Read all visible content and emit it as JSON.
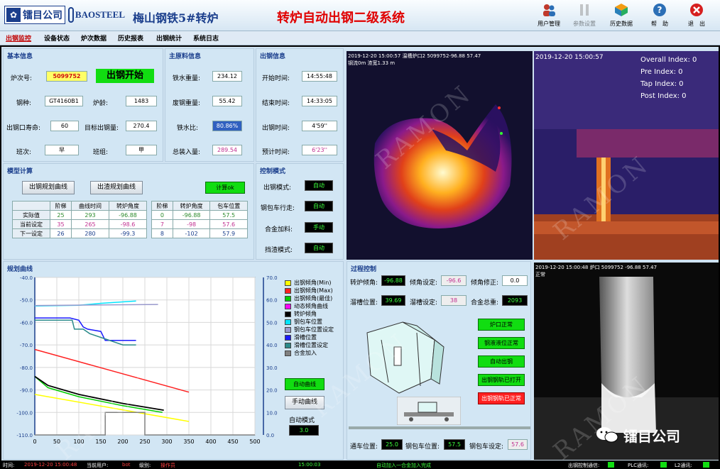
{
  "header": {
    "company_logo_text": "镭目公司",
    "baosteel_logo_text": "BAOSTEEL",
    "plant_title": "梅山钢铁5#转炉",
    "system_title": "转炉自动出钢二级系统",
    "toolbar": [
      {
        "label": "用户管理",
        "icon": "users-icon"
      },
      {
        "label": "参数设置",
        "icon": "settings-icon"
      },
      {
        "label": "历史数据",
        "icon": "history-icon"
      },
      {
        "label": "帮　助",
        "icon": "help-icon"
      },
      {
        "label": "退　出",
        "icon": "exit-icon"
      }
    ]
  },
  "menu": [
    "出钢监控",
    "设备状态",
    "炉次数据",
    "历史报表",
    "出钢统计",
    "系统日志"
  ],
  "basic_info": {
    "title": "基本信息",
    "heat_no_label": "炉次号:",
    "heat_no": "5099752",
    "tap_status": "出钢开始",
    "grade_label": "钢种:",
    "grade": "GT4160B1",
    "furnace_age_label": "炉龄:",
    "furnace_age": "1483",
    "tap_hole_life_label": "出钢口寿命:",
    "tap_hole_life": "60",
    "target_weight_label": "目标出钢量:",
    "target_weight": "270.4",
    "shift_label": "班次:",
    "shift": "早",
    "team_label": "班组:",
    "team": "甲"
  },
  "material_info": {
    "title": "主原料信息",
    "iron_weight_label": "铁水重量:",
    "iron_weight": "234.12",
    "scrap_weight_label": "废钢重量:",
    "scrap_weight": "55.42",
    "iron_ratio_label": "铁水比:",
    "iron_ratio": "80.86%",
    "total_charge_label": "总装入量:",
    "total_charge": "289.54"
  },
  "tap_info": {
    "title": "出钢信息",
    "start_label": "开始时间:",
    "start": "14:55:48",
    "end_label": "结束时间:",
    "end": "14:33:05",
    "duration_label": "出钢时间:",
    "duration": "4'59''",
    "predicted_label": "预计时间:",
    "predicted": "6'23''"
  },
  "model_calc": {
    "title": "模型计算",
    "btn_tap_curve": "出钢规划曲线",
    "btn_slag_curve": "出渣规划曲线",
    "btn_calc": "计算ok",
    "table_left": {
      "headers": [
        "",
        "阶梯",
        "曲线时间",
        "转炉角度"
      ],
      "rows": [
        [
          "实际值",
          "25",
          "293",
          "-96.88"
        ],
        [
          "当前设定",
          "35",
          "265",
          "-98.6"
        ],
        [
          "下一设定",
          "26",
          "280",
          "-99.3"
        ]
      ]
    },
    "table_right": {
      "headers": [
        "阶梯",
        "转炉角度",
        "包车位置"
      ],
      "rows": [
        [
          "0",
          "-96.88",
          "57.5"
        ],
        [
          "7",
          "-98",
          "57.6"
        ],
        [
          "8",
          "-102",
          "57.9"
        ]
      ]
    }
  },
  "control_mode": {
    "title": "控制模式",
    "items": [
      {
        "label": "出钢模式:",
        "value": "自动"
      },
      {
        "label": "钢包车行走:",
        "value": "自动"
      },
      {
        "label": "合金加料:",
        "value": "手动"
      },
      {
        "label": "挡渣模式:",
        "value": "自动"
      }
    ]
  },
  "planning_curve": {
    "title": "规划曲线",
    "legend": [
      {
        "label": "出钢倾角(Min)",
        "color": "#ffff00"
      },
      {
        "label": "出钢倾角(Max)",
        "color": "#ff2020"
      },
      {
        "label": "出钢倾角(最佳)",
        "color": "#00cc00"
      },
      {
        "label": "动态倾角曲线",
        "color": "#ff00ff"
      },
      {
        "label": "转炉倾角",
        "color": "#000000"
      },
      {
        "label": "钢包车位置",
        "color": "#00e5ff"
      },
      {
        "label": "钢包车位置设定",
        "color": "#9999cc"
      },
      {
        "label": "滑槽位置",
        "color": "#1a1aff"
      },
      {
        "label": "滑槽位置设定",
        "color": "#2a8a8a"
      },
      {
        "label": "合金加入",
        "color": "#808080"
      }
    ],
    "btn_auto_curve": "自动曲线",
    "btn_manual_curve": "手动曲线",
    "auto_mode_label": "自动模式",
    "auto_mode_value": "3.0"
  },
  "chart_data": {
    "type": "line",
    "x_ticks": [
      "0",
      "50",
      "100",
      "150",
      "200",
      "250",
      "300",
      "350",
      "400",
      "450",
      "500"
    ],
    "y_left_ticks": [
      "-40.0",
      "-50.0",
      "-60.0",
      "-70.0",
      "-80.0",
      "-90.0",
      "-100.0",
      "-110.0"
    ],
    "y_right_ticks": [
      "70.0",
      "60.0",
      "50.0",
      "40.0",
      "30.0",
      "20.0",
      "10.0",
      "0.0"
    ],
    "xlim": [
      0,
      500
    ],
    "ylim_left": [
      -110,
      -40
    ],
    "ylim_right": [
      0,
      70
    ],
    "series": [
      {
        "name": "出钢倾角(Min)",
        "axis": "left",
        "color": "#ffff00",
        "x": [
          0,
          350
        ],
        "y": [
          -92,
          -104
        ]
      },
      {
        "name": "出钢倾角(Max)",
        "axis": "left",
        "color": "#ff2020",
        "x": [
          0,
          350
        ],
        "y": [
          -72,
          -91
        ]
      },
      {
        "name": "出钢倾角(最佳)",
        "axis": "left",
        "color": "#00cc00",
        "x": [
          0,
          30,
          100,
          200,
          290
        ],
        "y": [
          -84,
          -89,
          -93,
          -97,
          -100
        ]
      },
      {
        "name": "转炉倾角",
        "axis": "left",
        "color": "#000000",
        "x": [
          0,
          30,
          100,
          200,
          293
        ],
        "y": [
          -84,
          -88,
          -92,
          -96,
          -99
        ]
      },
      {
        "name": "钢包车位置",
        "axis": "right",
        "color": "#00e5ff",
        "x": [
          0,
          100,
          150,
          230
        ],
        "y": [
          57.3,
          57.6,
          58.5,
          59.5
        ]
      },
      {
        "name": "钢包车位置设定",
        "axis": "right",
        "color": "#9999cc",
        "x": [
          0,
          280
        ],
        "y": [
          57.5,
          58
        ]
      },
      {
        "name": "滑槽位置",
        "axis": "right",
        "color": "#1a1aff",
        "x": [
          0,
          80,
          100,
          110,
          120,
          150,
          160,
          230
        ],
        "y": [
          52,
          52,
          51,
          48,
          47,
          46,
          42,
          42
        ]
      },
      {
        "name": "滑槽位置设定",
        "axis": "right",
        "color": "#2a8a8a",
        "x": [
          0,
          85,
          90,
          110,
          125,
          200,
          230
        ],
        "y": [
          51,
          51,
          47,
          47,
          45,
          40,
          40
        ]
      },
      {
        "name": "合金加入",
        "axis": "right",
        "color": "#808080",
        "x": [
          0,
          160,
          160,
          250,
          250,
          500
        ],
        "y": [
          0,
          0,
          10,
          10,
          0,
          0
        ]
      }
    ]
  },
  "process_control": {
    "title": "过程控制",
    "tilt_label": "转炉倾角:",
    "tilt": "-96.88",
    "tilt_set_label": "倾角设定:",
    "tilt_set": "-96.6",
    "tilt_correction_label": "倾角修正:",
    "tilt_correction": "0.0",
    "chute_pos_label": "溜槽位置:",
    "chute_pos": "39.69",
    "chute_set_label": "溜槽设定:",
    "chute_set": "38",
    "alloy_weight_label": "合金总重:",
    "alloy_weight": "2093",
    "buttons": [
      {
        "label": "炉口正常",
        "color": "#11dd11"
      },
      {
        "label": "钢液液位正常",
        "color": "#11dd11"
      },
      {
        "label": "自动出钢",
        "color": "#11dd11"
      },
      {
        "label": "出钢钢轨已打开",
        "color": "#11dd11"
      },
      {
        "label": "出钢钢轨已正常",
        "color": "#ff2020"
      }
    ],
    "car_pos_label": "通车位置:",
    "car_pos": "25.0",
    "ladle_pos_label": "钢包车位置:",
    "ladle_pos": "57.5",
    "ladle_set_label": "钢包车设定:",
    "ladle_set": "57.6"
  },
  "cameras": {
    "cam1_overlay": "2019-12-20 15:00:57 温槽炉口2 5099752-96.88 57.47",
    "cam1_overlay2": "钢流0m 渣宽1.33 m",
    "cam2_time": "2019-12-20 15:00:57",
    "cam2_stats": [
      "Overall Index: 0",
      "Pre Index: 0",
      "Tap Index: 0",
      "Post Index: 0"
    ],
    "cam3_overlay": "2019-12-20 15:00:48 炉口 5099752 -96.88 57.47",
    "cam3_overlay2": "正常",
    "watermark": "RAMON"
  },
  "status_bar": {
    "time_label": "时间:",
    "time": "2019-12-20 15:00:48",
    "user_label": "当前用户:",
    "user": "bot",
    "level_label": "级别:",
    "level": "操作员",
    "center_clock": "15:00:03",
    "msg": "自动加入一合金加入完成",
    "tap_ctrl_label": "出钢控制通信:",
    "plc_label": "PLC通讯:",
    "l2_label": "L2通讯:"
  },
  "watermark_brand": "镭目公司"
}
